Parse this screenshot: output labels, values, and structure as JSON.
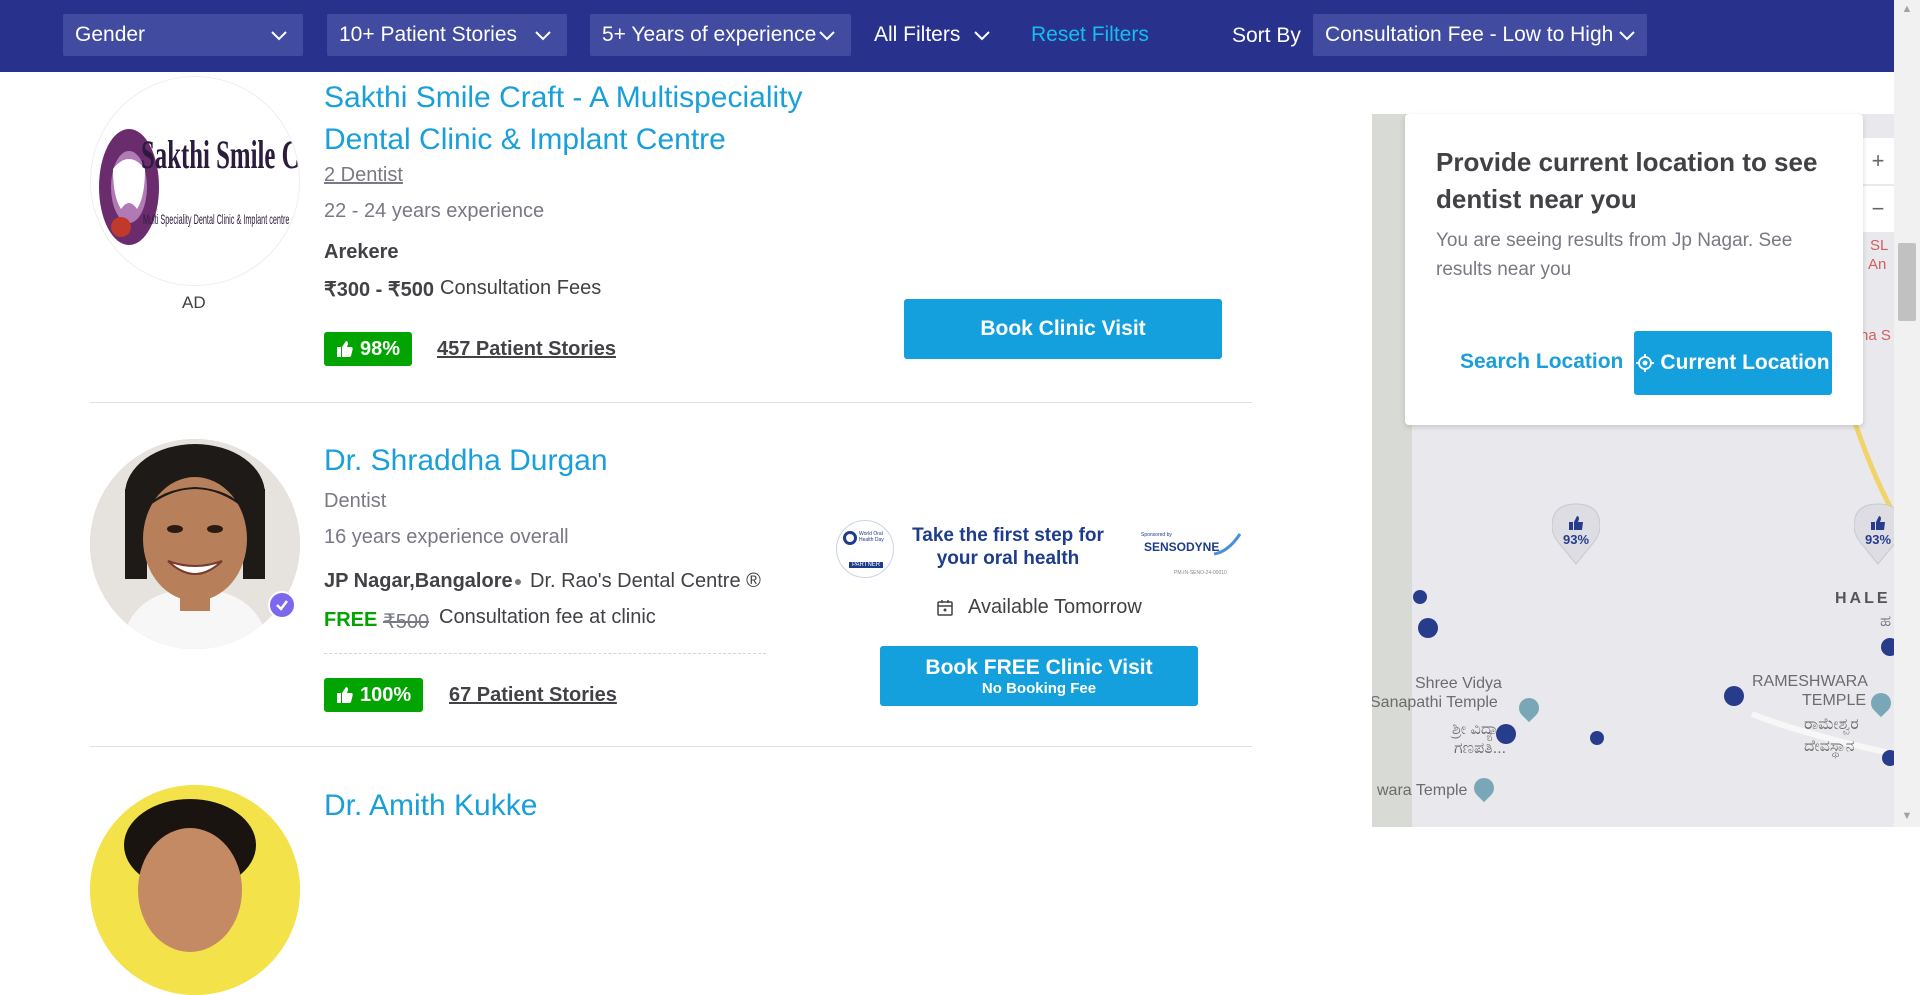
{
  "filters": {
    "gender": "Gender",
    "stories": "10+ Patient Stories",
    "experience": "5+ Years of experience",
    "all_filters": "All Filters",
    "reset": "Reset Filters",
    "sort_label": "Sort By",
    "sort_value": "Consultation Fee - Low to High"
  },
  "listings": [
    {
      "name_line1": "Sakthi Smile Craft - A Multispeciality",
      "name_line2": "Dental Clinic & Implant Centre",
      "dentists": "2 Dentist",
      "experience": "22 - 24 years experience",
      "location": "Arekere",
      "fee_range": "₹300 - ₹500",
      "fee_label": "Consultation Fees",
      "ad": "AD",
      "logo_text": "Sakthi Smile Craft",
      "logo_sub": "Multi Speciality Dental Clinic & Implant centre",
      "rating": "98%",
      "stories": "457 Patient Stories",
      "cta": "Book Clinic Visit"
    },
    {
      "name": "Dr. Shraddha Durgan",
      "speciality": "Dentist",
      "experience": "16 years experience overall",
      "location": "JP Nagar,Bangalore",
      "clinic": "Dr. Rao's Dental Centre ®",
      "fee_free": "FREE",
      "fee_strike": "₹500",
      "fee_label": "Consultation fee at clinic",
      "rating": "100%",
      "stories": "67 Patient Stories",
      "promo_line1": "Take the first step for",
      "promo_line2": "your oral health",
      "promo_sponsor": "SENSODYNE",
      "promo_sponsored_by": "Sponsored by",
      "promo_badge_top": "World Oral Health Day",
      "promo_badge_bottom": "PARTNER",
      "promo_code": "PM-IN-SENO-24-00010",
      "availability": "Available Tomorrow",
      "cta": "Book FREE Clinic Visit",
      "cta_sub": "No Booking Fee"
    },
    {
      "name": "Dr. Amith Kukke"
    }
  ],
  "location_popup": {
    "title": "Provide current location to see dentist near you",
    "description": "You are seeing results from Jp Nagar. See results near you",
    "search": "Search Location",
    "current": "Current Location"
  },
  "map": {
    "zoom_in": "+",
    "zoom_out": "−",
    "pin1_pct": "93%",
    "pin2_pct": "93%",
    "label_sl": "SL",
    "label_an": "An",
    "label_nas": "na S",
    "label_hale": "HALE",
    "label_hale_kn": "ಹ",
    "label_temple1_a": "Shree Vidya",
    "label_temple1_b": "Sanapathi Temple",
    "label_temple1_kn": "ಶ್ರೀ ವಿದ್ಯಾ",
    "label_temple1_kn2": "ಗಣಪತಿ...",
    "label_temple2_a": "RAMESHWARA",
    "label_temple2_b": "TEMPLE",
    "label_temple2_kn": "ರಾಮೇಶ್ವರ",
    "label_temple2_kn2": "ದೇವಸ್ಥಾನ",
    "label_vara": "wara Temple"
  },
  "colors": {
    "header_bg": "#28328c",
    "link": "#199fd9",
    "button": "#14a0dc",
    "rating_green": "#01a400"
  }
}
